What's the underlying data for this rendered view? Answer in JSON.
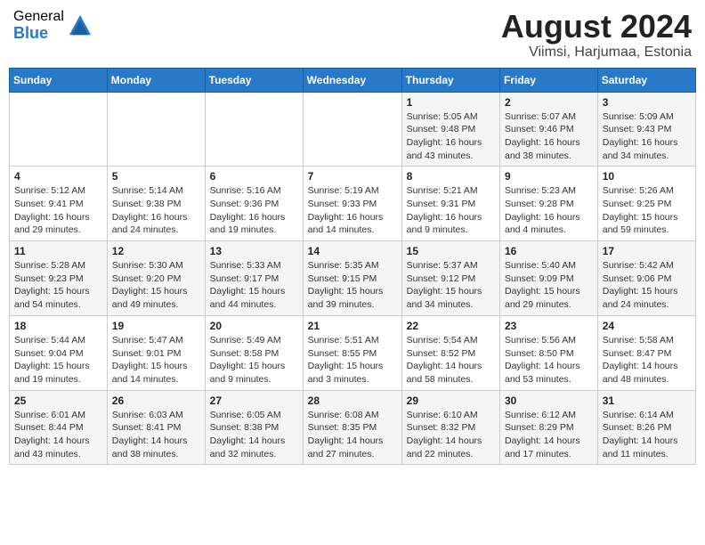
{
  "header": {
    "logo_general": "General",
    "logo_blue": "Blue",
    "month_year": "August 2024",
    "location": "Viimsi, Harjumaa, Estonia"
  },
  "days_of_week": [
    "Sunday",
    "Monday",
    "Tuesday",
    "Wednesday",
    "Thursday",
    "Friday",
    "Saturday"
  ],
  "weeks": [
    [
      {
        "day": "",
        "info": ""
      },
      {
        "day": "",
        "info": ""
      },
      {
        "day": "",
        "info": ""
      },
      {
        "day": "",
        "info": ""
      },
      {
        "day": "1",
        "info": "Sunrise: 5:05 AM\nSunset: 9:48 PM\nDaylight: 16 hours\nand 43 minutes."
      },
      {
        "day": "2",
        "info": "Sunrise: 5:07 AM\nSunset: 9:46 PM\nDaylight: 16 hours\nand 38 minutes."
      },
      {
        "day": "3",
        "info": "Sunrise: 5:09 AM\nSunset: 9:43 PM\nDaylight: 16 hours\nand 34 minutes."
      }
    ],
    [
      {
        "day": "4",
        "info": "Sunrise: 5:12 AM\nSunset: 9:41 PM\nDaylight: 16 hours\nand 29 minutes."
      },
      {
        "day": "5",
        "info": "Sunrise: 5:14 AM\nSunset: 9:38 PM\nDaylight: 16 hours\nand 24 minutes."
      },
      {
        "day": "6",
        "info": "Sunrise: 5:16 AM\nSunset: 9:36 PM\nDaylight: 16 hours\nand 19 minutes."
      },
      {
        "day": "7",
        "info": "Sunrise: 5:19 AM\nSunset: 9:33 PM\nDaylight: 16 hours\nand 14 minutes."
      },
      {
        "day": "8",
        "info": "Sunrise: 5:21 AM\nSunset: 9:31 PM\nDaylight: 16 hours\nand 9 minutes."
      },
      {
        "day": "9",
        "info": "Sunrise: 5:23 AM\nSunset: 9:28 PM\nDaylight: 16 hours\nand 4 minutes."
      },
      {
        "day": "10",
        "info": "Sunrise: 5:26 AM\nSunset: 9:25 PM\nDaylight: 15 hours\nand 59 minutes."
      }
    ],
    [
      {
        "day": "11",
        "info": "Sunrise: 5:28 AM\nSunset: 9:23 PM\nDaylight: 15 hours\nand 54 minutes."
      },
      {
        "day": "12",
        "info": "Sunrise: 5:30 AM\nSunset: 9:20 PM\nDaylight: 15 hours\nand 49 minutes."
      },
      {
        "day": "13",
        "info": "Sunrise: 5:33 AM\nSunset: 9:17 PM\nDaylight: 15 hours\nand 44 minutes."
      },
      {
        "day": "14",
        "info": "Sunrise: 5:35 AM\nSunset: 9:15 PM\nDaylight: 15 hours\nand 39 minutes."
      },
      {
        "day": "15",
        "info": "Sunrise: 5:37 AM\nSunset: 9:12 PM\nDaylight: 15 hours\nand 34 minutes."
      },
      {
        "day": "16",
        "info": "Sunrise: 5:40 AM\nSunset: 9:09 PM\nDaylight: 15 hours\nand 29 minutes."
      },
      {
        "day": "17",
        "info": "Sunrise: 5:42 AM\nSunset: 9:06 PM\nDaylight: 15 hours\nand 24 minutes."
      }
    ],
    [
      {
        "day": "18",
        "info": "Sunrise: 5:44 AM\nSunset: 9:04 PM\nDaylight: 15 hours\nand 19 minutes."
      },
      {
        "day": "19",
        "info": "Sunrise: 5:47 AM\nSunset: 9:01 PM\nDaylight: 15 hours\nand 14 minutes."
      },
      {
        "day": "20",
        "info": "Sunrise: 5:49 AM\nSunset: 8:58 PM\nDaylight: 15 hours\nand 9 minutes."
      },
      {
        "day": "21",
        "info": "Sunrise: 5:51 AM\nSunset: 8:55 PM\nDaylight: 15 hours\nand 3 minutes."
      },
      {
        "day": "22",
        "info": "Sunrise: 5:54 AM\nSunset: 8:52 PM\nDaylight: 14 hours\nand 58 minutes."
      },
      {
        "day": "23",
        "info": "Sunrise: 5:56 AM\nSunset: 8:50 PM\nDaylight: 14 hours\nand 53 minutes."
      },
      {
        "day": "24",
        "info": "Sunrise: 5:58 AM\nSunset: 8:47 PM\nDaylight: 14 hours\nand 48 minutes."
      }
    ],
    [
      {
        "day": "25",
        "info": "Sunrise: 6:01 AM\nSunset: 8:44 PM\nDaylight: 14 hours\nand 43 minutes."
      },
      {
        "day": "26",
        "info": "Sunrise: 6:03 AM\nSunset: 8:41 PM\nDaylight: 14 hours\nand 38 minutes."
      },
      {
        "day": "27",
        "info": "Sunrise: 6:05 AM\nSunset: 8:38 PM\nDaylight: 14 hours\nand 32 minutes."
      },
      {
        "day": "28",
        "info": "Sunrise: 6:08 AM\nSunset: 8:35 PM\nDaylight: 14 hours\nand 27 minutes."
      },
      {
        "day": "29",
        "info": "Sunrise: 6:10 AM\nSunset: 8:32 PM\nDaylight: 14 hours\nand 22 minutes."
      },
      {
        "day": "30",
        "info": "Sunrise: 6:12 AM\nSunset: 8:29 PM\nDaylight: 14 hours\nand 17 minutes."
      },
      {
        "day": "31",
        "info": "Sunrise: 6:14 AM\nSunset: 8:26 PM\nDaylight: 14 hours\nand 11 minutes."
      }
    ]
  ]
}
